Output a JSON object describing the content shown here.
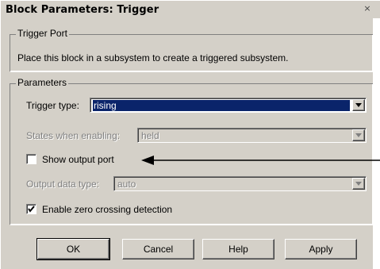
{
  "window": {
    "title": "Block Parameters: Trigger",
    "close_glyph": "×"
  },
  "trigger_port": {
    "legend": "Trigger Port",
    "description": "Place this block in a subsystem to create a triggered subsystem."
  },
  "parameters": {
    "legend": "Parameters",
    "trigger_type": {
      "label": "Trigger type:",
      "value": "rising"
    },
    "states_when_enabling": {
      "label": "States when enabling:",
      "value": "held",
      "enabled": false
    },
    "show_output_port": {
      "label": "Show output port",
      "checked": false
    },
    "output_data_type": {
      "label": "Output data type:",
      "value": "auto",
      "enabled": false
    },
    "enable_zero_crossing": {
      "label": "Enable zero crossing detection",
      "checked": true
    }
  },
  "buttons": {
    "ok": "OK",
    "cancel": "Cancel",
    "help": "Help",
    "apply": "Apply"
  },
  "annotation": {
    "icon": "arrow-left-icon"
  }
}
